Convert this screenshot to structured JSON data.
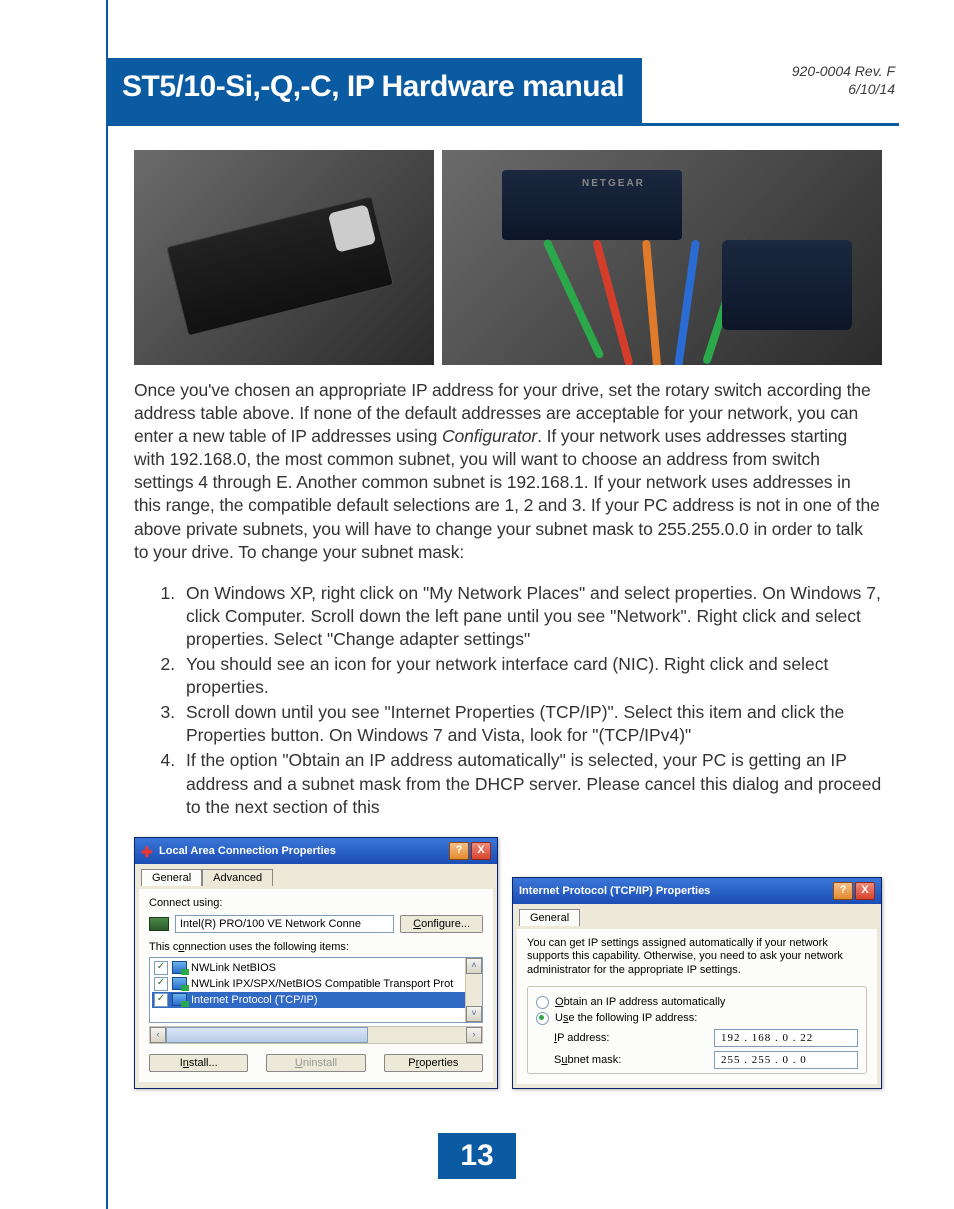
{
  "header": {
    "title": "ST5/10-Si,-Q,-C, IP Hardware manual",
    "doc_ref": "920-0004 Rev. F",
    "date": "6/10/14"
  },
  "photo2": {
    "switch_brand": "NETGEAR"
  },
  "body_paragraph": "Once you've chosen an appropriate IP address for your drive, set the rotary switch according the address table above.  If none of the default addresses are acceptable for your network, you can enter a new table of IP addresses using Configurator.  If your network uses addresses starting with 192.168.0, the most common subnet, you will want to choose an address from switch settings 4 through E.  Another common subnet is 192.168.1.  If your network uses addresses in this range, the compatible default selections are 1, 2 and 3.  If your PC address is not in one of the above private subnets, you will have to change your subnet mask to 255.255.0.0 in order to talk to your drive.  To change your subnet mask:",
  "steps": [
    "On Windows XP, right click on \"My Network Places\" and select properties.  On Windows 7, click Computer.  Scroll down the left pane until you see \"Network\".  Right click and select properties.  Select \"Change adapter settings\"",
    "You should see an icon for your network interface card (NIC).  Right click and select properties.",
    "Scroll down until you see \"Internet Properties (TCP/IP)\".  Select this item and click the Properties button.  On Windows 7 and Vista, look for \"(TCP/IPv4)\"",
    "If the option \"Obtain an IP address automatically\" is selected, your PC is getting an IP address and a subnet mask from the DHCP server.  Please cancel this dialog and proceed to the next section of this"
  ],
  "dialog1": {
    "title": "Local Area Connection Properties",
    "tabs": {
      "general": "General",
      "advanced": "Advanced"
    },
    "connect_using_label": "Connect using:",
    "adapter": "Intel(R) PRO/100 VE Network Conne",
    "configure_btn": "Configure...",
    "items_label": "This connection uses the following items:",
    "items": [
      "NWLink NetBIOS",
      "NWLink IPX/SPX/NetBIOS Compatible Transport Prot",
      "Internet Protocol (TCP/IP)"
    ],
    "install_btn": "Install...",
    "uninstall_btn": "Uninstall",
    "properties_btn": "Properties"
  },
  "dialog2": {
    "title": "Internet Protocol (TCP/IP) Properties",
    "tab_general": "General",
    "helptext": "You can get IP settings assigned automatically if your network supports this capability. Otherwise, you need to ask your network administrator for the appropriate IP settings.",
    "radio_auto": "Obtain an IP address automatically",
    "radio_manual": "Use the following IP address:",
    "ip_label": "IP address:",
    "ip_value": "192 . 168 .   0  .  22",
    "subnet_label": "Subnet mask:",
    "subnet_value": "255 . 255 .   0  .   0"
  },
  "page_number": "13",
  "glyphs": {
    "help": "?",
    "close": "X",
    "check": "✓",
    "up": "˄",
    "down": "˅",
    "left": "‹",
    "right": "›",
    "plus": "✚"
  }
}
